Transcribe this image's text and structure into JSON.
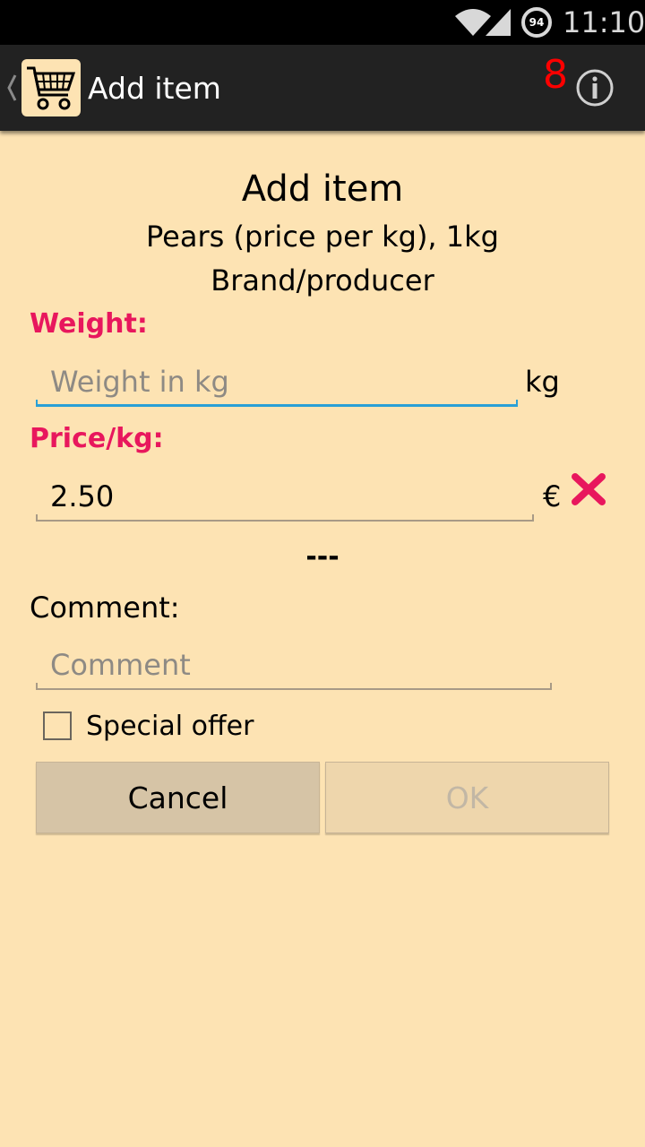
{
  "status_bar": {
    "battery_level": "94",
    "time": "11:10",
    "icons": [
      "wifi-icon",
      "cell-signal-icon",
      "battery-icon"
    ]
  },
  "action_bar": {
    "title": "Add item",
    "item_count": "8",
    "icons": [
      "up-caret-icon",
      "shopping-cart-icon",
      "info-icon"
    ]
  },
  "form": {
    "heading": "Add item",
    "product": "Pears (price per kg), 1kg",
    "brand": "Brand/producer",
    "weight_label": "Weight:",
    "weight_placeholder": "Weight in kg",
    "weight_unit": "kg",
    "price_label": "Price/kg:",
    "price_value": "2.50",
    "price_unit": "€",
    "computed_total": "---",
    "comment_label": "Comment:",
    "comment_placeholder": "Comment",
    "special_offer_label": "Special offer",
    "special_offer_checked": false,
    "cancel_label": "Cancel",
    "ok_label": "OK"
  },
  "colors": {
    "background": "#fde3b3",
    "label_accent": "#e8175d",
    "focus_underline": "#2a9fd6",
    "count_red": "#ff0000",
    "clear_icon": "#e8175d"
  }
}
